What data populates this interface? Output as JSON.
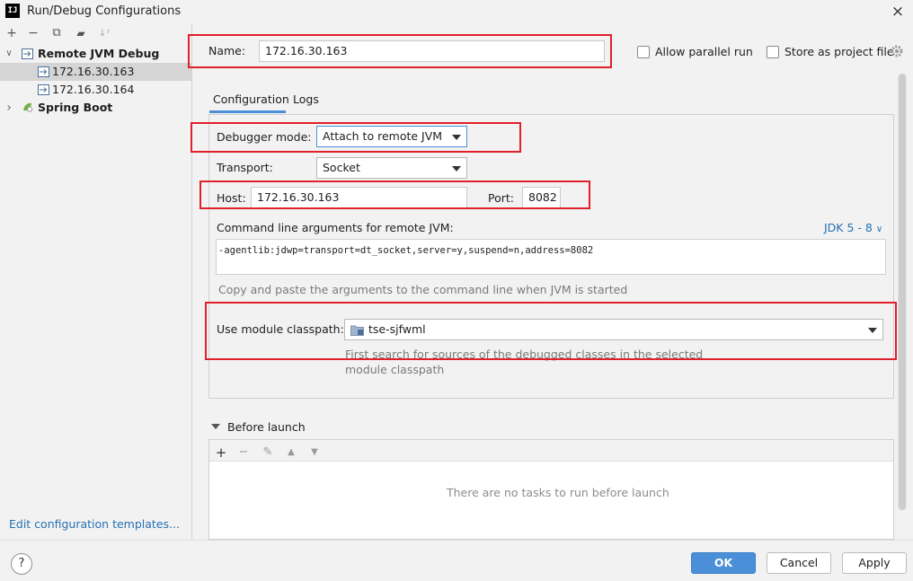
{
  "window": {
    "app_icon": "IJ",
    "title": "Run/Debug Configurations",
    "close_icon": "×"
  },
  "toolbar": {
    "add": "+",
    "remove": "−",
    "copy": "⧉",
    "folder": "▰",
    "sort": "↓ᶻ"
  },
  "tree": {
    "remote_jvm": {
      "label": "Remote JVM Debug",
      "expanded_arrow": "∨"
    },
    "children": [
      {
        "label": "172.16.30.163"
      },
      {
        "label": "172.16.30.164"
      }
    ],
    "spring_boot": {
      "label": "Spring Boot",
      "collapsed_arrow": "›"
    }
  },
  "edit_templates": "Edit configuration templates...",
  "config": {
    "name_label": "Name:",
    "name_value": "172.16.30.163",
    "allow_parallel": "Allow parallel run",
    "store_project": "Store as project file",
    "tabs": [
      "Configuration",
      "Logs"
    ],
    "debugger_mode_label": "Debugger mode:",
    "debugger_mode_value": "Attach to remote JVM",
    "transport_label": "Transport:",
    "transport_value": "Socket",
    "host_label": "Host:",
    "host_value": "172.16.30.163",
    "port_label": "Port:",
    "port_value": "8082",
    "cmd_label": "Command line arguments for remote JVM:",
    "jdk_label": "JDK 5 - 8",
    "jdk_caret": "∨",
    "cmd_value": "-agentlib:jdwp=transport=dt_socket,server=y,suspend=n,address=8082",
    "cmd_hint": "Copy and paste the arguments to the command line when JVM is started",
    "module_label": "Use module classpath:",
    "module_value": "tse-sjfwml",
    "module_hint_1": "First search for sources of the debugged classes in the selected",
    "module_hint_2": "module classpath"
  },
  "before_launch": {
    "title": "Before launch",
    "add": "+",
    "remove": "−",
    "edit": "✎",
    "up": "▲",
    "down": "▼",
    "empty": "There are no tasks to run before launch"
  },
  "buttons": {
    "help": "?",
    "ok": "OK",
    "cancel": "Cancel",
    "apply": "Apply"
  },
  "colors": {
    "accent": "#4a8fd8",
    "highlight": "#e0202a",
    "link": "#2470b3"
  }
}
